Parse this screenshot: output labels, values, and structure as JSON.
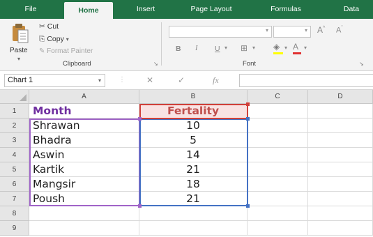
{
  "ribbon": {
    "tabs": [
      {
        "label": "File",
        "active": false
      },
      {
        "label": "Home",
        "active": true
      },
      {
        "label": "Insert",
        "active": false
      },
      {
        "label": "Page Layout",
        "active": false
      },
      {
        "label": "Formulas",
        "active": false
      },
      {
        "label": "Data",
        "active": false
      }
    ],
    "clipboard": {
      "paste_label": "Paste",
      "cut_label": "Cut",
      "copy_label": "Copy",
      "format_painter_label": "Format Painter",
      "group_label": "Clipboard"
    },
    "font": {
      "bold_label": "B",
      "italic_label": "I",
      "underline_label": "U",
      "font_color_label": "A",
      "grow_label": "A",
      "shrink_label": "A",
      "group_label": "Font"
    }
  },
  "formula_bar": {
    "name_box": "Chart 1",
    "fx_label": "fx",
    "formula": ""
  },
  "sheet": {
    "columns": [
      "A",
      "B",
      "C",
      "D"
    ],
    "rows": [
      "1",
      "2",
      "3",
      "4",
      "5",
      "6",
      "7",
      "8",
      "9"
    ],
    "header_row": [
      "Month",
      "Fertality"
    ],
    "data_rows": [
      [
        "Shrawan",
        "10"
      ],
      [
        "Bhadra",
        "5"
      ],
      [
        "Aswin",
        "14"
      ],
      [
        "Kartik",
        "21"
      ],
      [
        "Mangsir",
        "18"
      ],
      [
        "Poush",
        "21"
      ]
    ]
  },
  "colors": {
    "ribbon_green": "#217346",
    "month_header": "#7030a0",
    "fertality_header": "#c0504d",
    "series_range_border": "#4472c4",
    "category_range_border": "#a064c8",
    "name_range_border": "#d0403a"
  }
}
